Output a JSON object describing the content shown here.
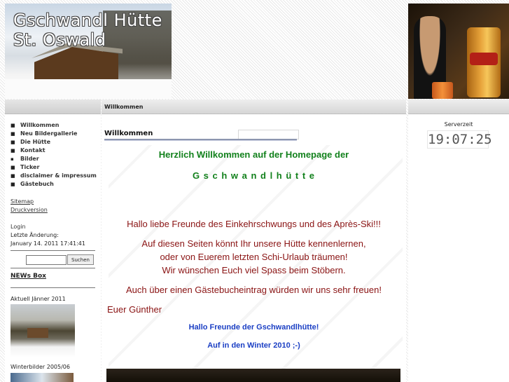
{
  "header": {
    "title_line1": "Gschwandl Hütte",
    "title_line2": "St. Oswald"
  },
  "sidebar": {
    "nav": [
      {
        "label": "Willkommen",
        "bullet": "■"
      },
      {
        "label": "Neu Bildergallerie",
        "bullet": "■"
      },
      {
        "label": "Die Hütte",
        "bullet": "■"
      },
      {
        "label": "Kontakt",
        "bullet": "■"
      },
      {
        "label": "Bilder",
        "bullet": "▪"
      },
      {
        "label": "Ticker",
        "bullet": "■"
      },
      {
        "label": "disclaimer & impressum",
        "bullet": "■"
      },
      {
        "label": "Gästebuch",
        "bullet": "■"
      }
    ],
    "sitemap": "Sitemap",
    "print": "Druckversion",
    "login": "Login",
    "last_change_label": "Letzte Änderung:",
    "last_change_date": "January 14. 2011 17:41:41",
    "search_button": "Suchen",
    "news_box": "NEWs Box",
    "news_item1": "Aktuell Jänner 2011",
    "news_item2": "Winterbilder 2005/06"
  },
  "main": {
    "bar_title": "Willkommen",
    "heading": "Willkommen",
    "welcome_line1": "Herzlich Willkommen auf der Homepage der",
    "welcome_line2": "G s c h w a n d l h ü t t e",
    "p1": "Hallo liebe Freunde des Einkehrschwungs und des Après-Ski!!!",
    "p2": "Auf diesen Seiten könnt Ihr unsere Hütte kennenlernen,",
    "p3": "oder von Euerem letzten Schi-Urlaub träumen!",
    "p4": "Wir wünschen Euch viel Spass beim Stöbern.",
    "p5": "Auch über einen Gästebucheintrag würden wir uns sehr freuen!",
    "signature": "Euer Günther",
    "blue1": "Hallo Freunde der Gschwandlhütte!",
    "blue2": "Auf in den Winter 2010 ;-)"
  },
  "right": {
    "server_label": "Serverzeit",
    "clock": "19:07:25"
  }
}
